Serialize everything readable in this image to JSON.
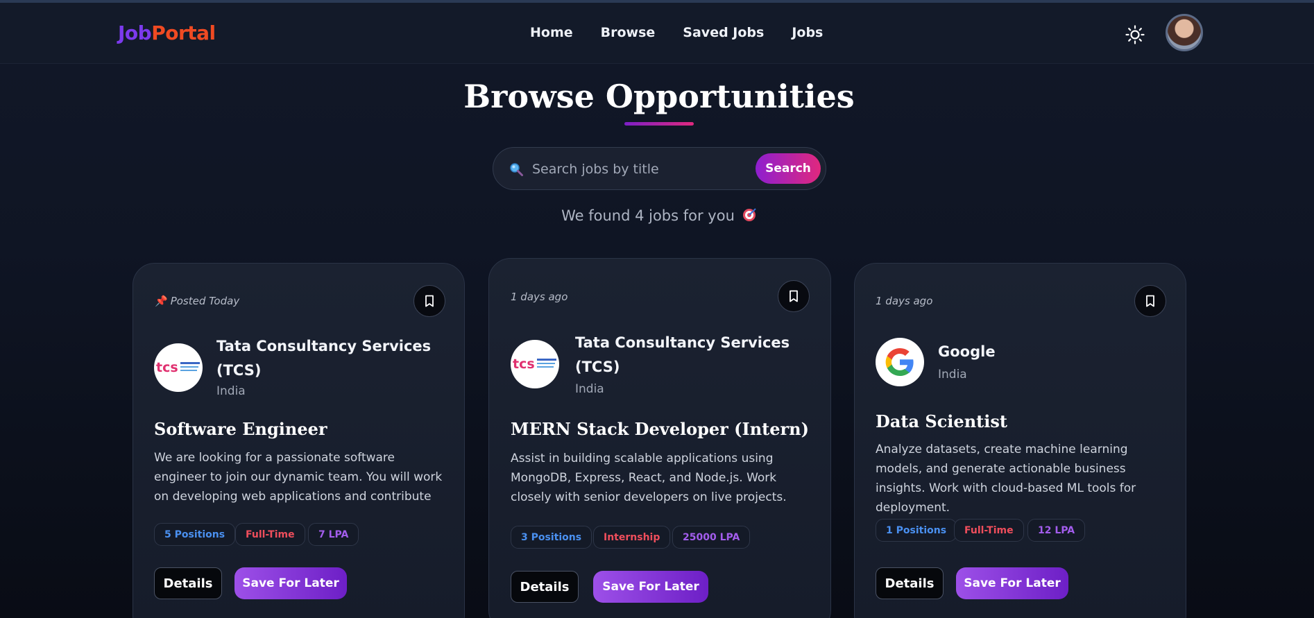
{
  "navbar": {
    "logo_part1": "Job",
    "logo_part2": "Portal",
    "links": [
      "Home",
      "Browse",
      "Saved Jobs",
      "Jobs"
    ],
    "theme_icon": "sun-icon",
    "avatar_icon": "user-avatar"
  },
  "hero": {
    "title": "Browse Opportunities",
    "search_placeholder": "Search jobs by title",
    "search_button": "Search",
    "results_text": "We found 4 jobs for you",
    "results_icon": "dart-target-icon"
  },
  "colors": {
    "logo_job": "#7c3aed",
    "logo_portal": "#f04a22",
    "accent_gradient_start": "#8e1fcf",
    "accent_gradient_end": "#e0287e",
    "tag_positions": "#4a90f0",
    "tag_type": "#ef4e5c",
    "tag_salary": "#a35ded"
  },
  "jobs": [
    {
      "posted": "Posted Today",
      "posted_icon": "pin-icon",
      "company": "Tata Consultancy Services (TCS)",
      "logo": "TCS",
      "location": "India",
      "title": "Software Engineer",
      "description": "We are looking for a passionate software engineer to join our dynamic team. You will work on developing web applications and contribute to exciting projects...",
      "positions": "5 Positions",
      "job_type": "Full-Time",
      "salary": "7 LPA",
      "details_label": "Details",
      "save_label": "Save For Later"
    },
    {
      "posted": "1 days ago",
      "company": "Tata Consultancy Services (TCS)",
      "logo": "TCS",
      "location": "India",
      "title": "MERN Stack Developer (Intern)",
      "description": "Assist in building scalable applications using MongoDB, Express, React, and Node.js. Work closely with senior developers on live projects.",
      "positions": "3 Positions",
      "job_type": "Internship",
      "salary": "25000 LPA",
      "details_label": "Details",
      "save_label": "Save For Later"
    },
    {
      "posted": "1 days ago",
      "company": "Google",
      "logo": "Google",
      "location": "India",
      "title": "Data Scientist",
      "description": "Analyze datasets, create machine learning models, and generate actionable business insights. Work with cloud-based ML tools for deployment.",
      "positions": "1 Positions",
      "job_type": "Full-Time",
      "salary": "12 LPA",
      "details_label": "Details",
      "save_label": "Save For Later"
    }
  ]
}
